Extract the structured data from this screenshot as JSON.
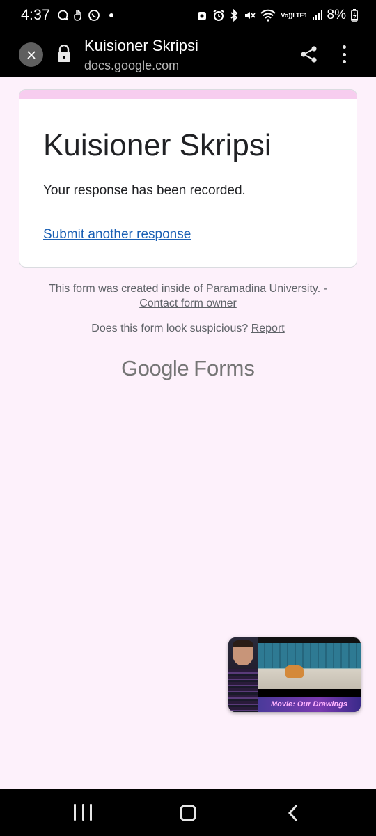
{
  "status_bar": {
    "time": "4:37",
    "battery": "8%",
    "network_top": "Vo))",
    "network_bottom": "LTE1"
  },
  "toolbar": {
    "title": "Kuisioner Skripsi",
    "url": "docs.google.com"
  },
  "card": {
    "title": "Kuisioner Skripsi",
    "message": "Your response has been recorded.",
    "submit_another": "Submit another response",
    "accent_color": "#f7cdef"
  },
  "footer": {
    "created_text": "This form was created inside of Paramadina University. -",
    "contact_link": "Contact form owner",
    "suspicious_text": "Does this form look suspicious?",
    "report_link": "Report"
  },
  "brand": {
    "google": "Google",
    "forms": "Forms"
  },
  "pip": {
    "caption": "Movie: Our Drawings"
  },
  "theme": {
    "background": "#fdf1fb",
    "link_color": "#1a5fb4"
  }
}
